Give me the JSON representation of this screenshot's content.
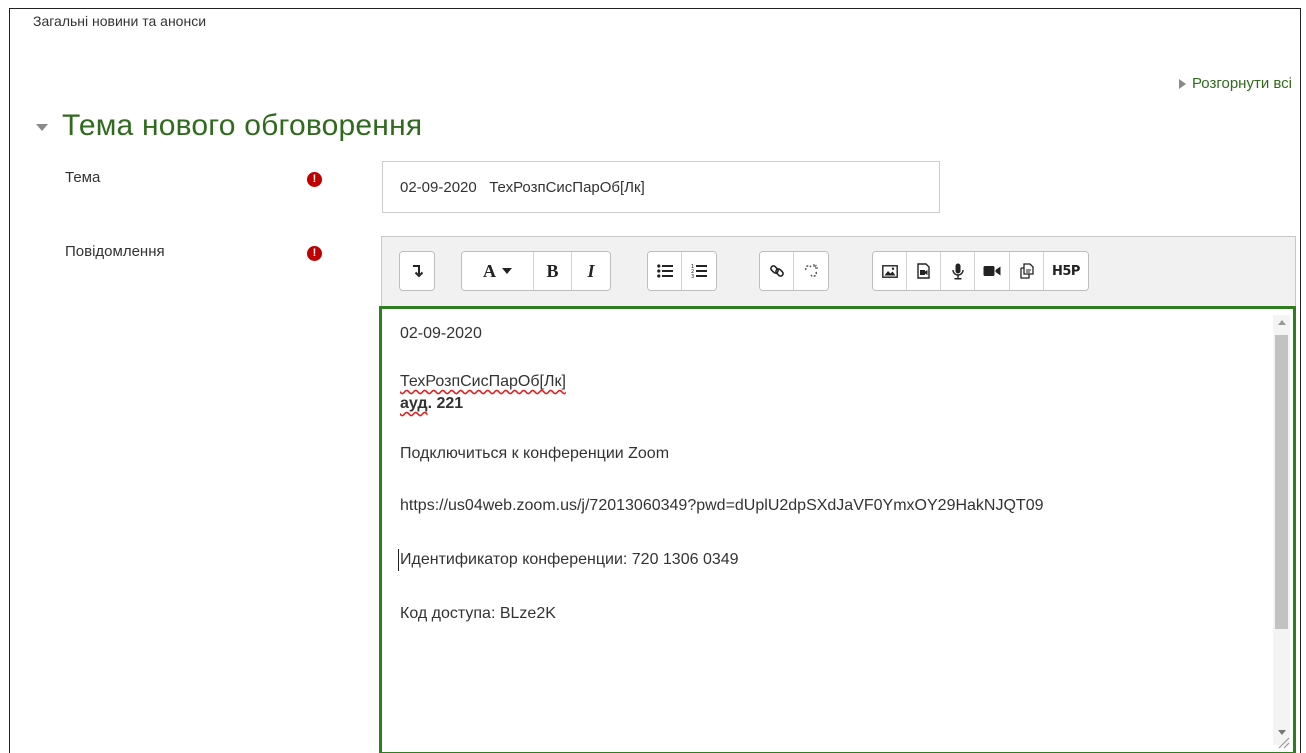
{
  "breadcrumb": {
    "forum_name": "Загальні новини та анонси"
  },
  "expand_all": {
    "label": "Розгорнути всі"
  },
  "section": {
    "title": "Тема нового обговорення"
  },
  "form": {
    "subject": {
      "label": "Тема",
      "value": "02-09-2020   ТехРозпСисПарОб[Лк]"
    },
    "message": {
      "label": "Повідомлення"
    },
    "required_icon": "exclamation-circle-icon"
  },
  "toolbar": {
    "groups": [
      [
        "collapse-toolbar-icon"
      ],
      [
        "font-style-dropdown",
        "bold-icon",
        "italic-icon"
      ],
      [
        "unordered-list-icon",
        "ordered-list-icon"
      ],
      [
        "link-icon",
        "unlink-icon"
      ],
      [
        "image-icon",
        "media-icon",
        "record-audio-icon",
        "record-video-icon",
        "manage-files-icon",
        "h5p-icon"
      ]
    ],
    "font_label": "A",
    "bold_label": "B",
    "italic_label": "I",
    "h5p_label": "H5P"
  },
  "editor": {
    "date_line": "02-09-2020",
    "course_code": "ТехРозпСисПарОб[Лк]",
    "room_prefix": "ауд",
    "room_rest": ". 221",
    "zoom_line": "Подключиться к конференции Zoom",
    "zoom_url": "https://us04web.zoom.us/j/72013060349?pwd=dUplU2dpSXdJaVF0YmxOY29HakNJQT09",
    "meeting_id_line": "Идентификатор конференции: 720 1306 0349",
    "access_code_line": "Код доступа: BLze2K"
  },
  "colors": {
    "accent_green": "#2f6a1f",
    "editor_border": "#2e7d1f",
    "required_red": "#c00000"
  }
}
